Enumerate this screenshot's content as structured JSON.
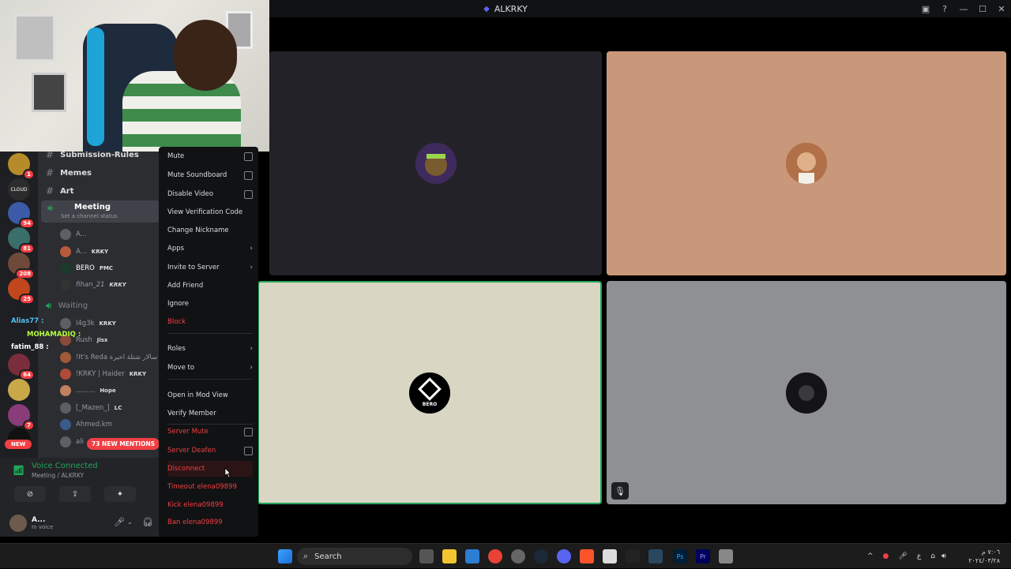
{
  "window": {
    "title": "ALKRKY"
  },
  "channels": [
    {
      "name": "Submission-Rules"
    },
    {
      "name": "Memes"
    },
    {
      "name": "Art"
    }
  ],
  "meeting": {
    "name": "Meeting",
    "status_placeholder": "Set a channel status"
  },
  "voice_members": [
    {
      "name": "A...",
      "tag": ""
    },
    {
      "name": "A...",
      "tag": "KRKY"
    },
    {
      "name": "BERO",
      "tag": "PMC"
    },
    {
      "name": "fihan_21",
      "tag": "KRKY"
    }
  ],
  "waiting": {
    "name": "Waiting"
  },
  "waiting_members": [
    {
      "name": "l4g3k",
      "tag": "KRKY"
    },
    {
      "name": "Rush",
      "tag": "Jisx"
    },
    {
      "name": "!It's Reda سالار شتلة اخيرة",
      "tag": ""
    },
    {
      "name": "!KRKY | Haider",
      "tag": "KRKY"
    },
    {
      "name": ".........",
      "tag": "Hope"
    },
    {
      "name": "[_Mazen_]",
      "tag": "LC"
    },
    {
      "name": "Ahmed.km",
      "tag": ""
    },
    {
      "name": "ali",
      "tag": ""
    }
  ],
  "chat_overlay": [
    {
      "name": "Alias77 :",
      "color": "#4fc3f7"
    },
    {
      "name": "MOHAMADIQ :",
      "color": "#b6ff3d"
    },
    {
      "name": "fatim_88 :",
      "color": "#ffffff"
    }
  ],
  "new_mentions": "73 NEW MENTIONS",
  "server_badges": [
    "1",
    "94",
    "81",
    "208",
    "25",
    "64",
    "7"
  ],
  "new_label": "NEW",
  "voice_panel": {
    "status": "Voice Connected",
    "location": "Meeting / ALKRKY",
    "user_name": "A...",
    "user_status": "In voice"
  },
  "context_menu": {
    "items": [
      {
        "label": "Mute",
        "type": "checkbox",
        "danger": false
      },
      {
        "label": "Mute Soundboard",
        "type": "checkbox",
        "danger": false
      },
      {
        "label": "Disable Video",
        "type": "checkbox",
        "danger": false
      },
      {
        "label": "View Verification Code",
        "type": "plain",
        "danger": false
      },
      {
        "label": "Change Nickname",
        "type": "plain",
        "danger": false
      },
      {
        "label": "Apps",
        "type": "submenu",
        "danger": false
      },
      {
        "label": "Invite to Server",
        "type": "submenu",
        "danger": false
      },
      {
        "label": "Add Friend",
        "type": "plain",
        "danger": false
      },
      {
        "label": "Ignore",
        "type": "plain",
        "danger": false
      },
      {
        "label": "Block",
        "type": "plain",
        "danger": true
      },
      {
        "label": "Roles",
        "type": "submenu",
        "danger": false
      },
      {
        "label": "Move to",
        "type": "submenu",
        "danger": false
      },
      {
        "label": "Open in Mod View",
        "type": "plain",
        "danger": false
      },
      {
        "label": "Verify Member",
        "type": "plain",
        "danger": false
      },
      {
        "label": "Server Mute",
        "type": "checkbox",
        "danger": true
      },
      {
        "label": "Server Deafen",
        "type": "checkbox",
        "danger": true
      },
      {
        "label": "Disconnect",
        "type": "plain",
        "danger": true
      },
      {
        "label": "Timeout elena09899",
        "type": "plain",
        "danger": true
      },
      {
        "label": "Kick elena09899",
        "type": "plain",
        "danger": true
      },
      {
        "label": "Ban elena09899",
        "type": "plain",
        "danger": true
      }
    ]
  },
  "video_tiles": [
    {
      "label": "",
      "bg": "#232228"
    },
    {
      "label": "",
      "bg": "#c9987b"
    },
    {
      "label": "BERO",
      "bg": "#d9d6c3"
    },
    {
      "label": "",
      "bg": "#8f9094"
    }
  ],
  "taskbar": {
    "search_label": "Search",
    "clock_time": "٧:٠٦ م",
    "clock_date": "٢٠٢٤/٠٣/٢٨"
  },
  "colors": {
    "accent": "#5865f2",
    "danger": "#f23f43",
    "online": "#23a55a",
    "speaking": "#23a55a"
  }
}
